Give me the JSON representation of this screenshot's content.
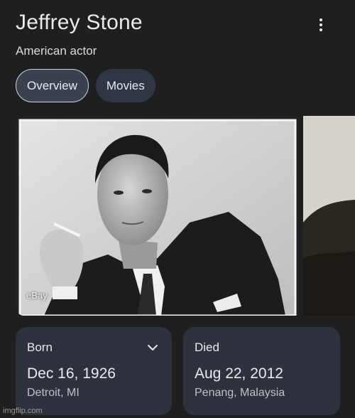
{
  "header": {
    "title": "Jeffrey Stone",
    "subtitle": "American actor"
  },
  "tabs": [
    {
      "label": "Overview",
      "active": true
    },
    {
      "label": "Movies",
      "active": false
    }
  ],
  "gallery": {
    "source_label": "eBay"
  },
  "facts": {
    "born": {
      "label": "Born",
      "date": "Dec 16, 1926",
      "place": "Detroit, MI"
    },
    "died": {
      "label": "Died",
      "date": "Aug 22, 2012",
      "place": "Penang, Malaysia"
    }
  },
  "watermark": "imgflip.com",
  "colors": {
    "background": "#1f1f1f",
    "card": "#2d323d",
    "tab_active_bg": "#3c4150",
    "tab_active_border": "#c9d4e8"
  },
  "icons": [
    "more-vert-icon",
    "chevron-down-icon"
  ]
}
